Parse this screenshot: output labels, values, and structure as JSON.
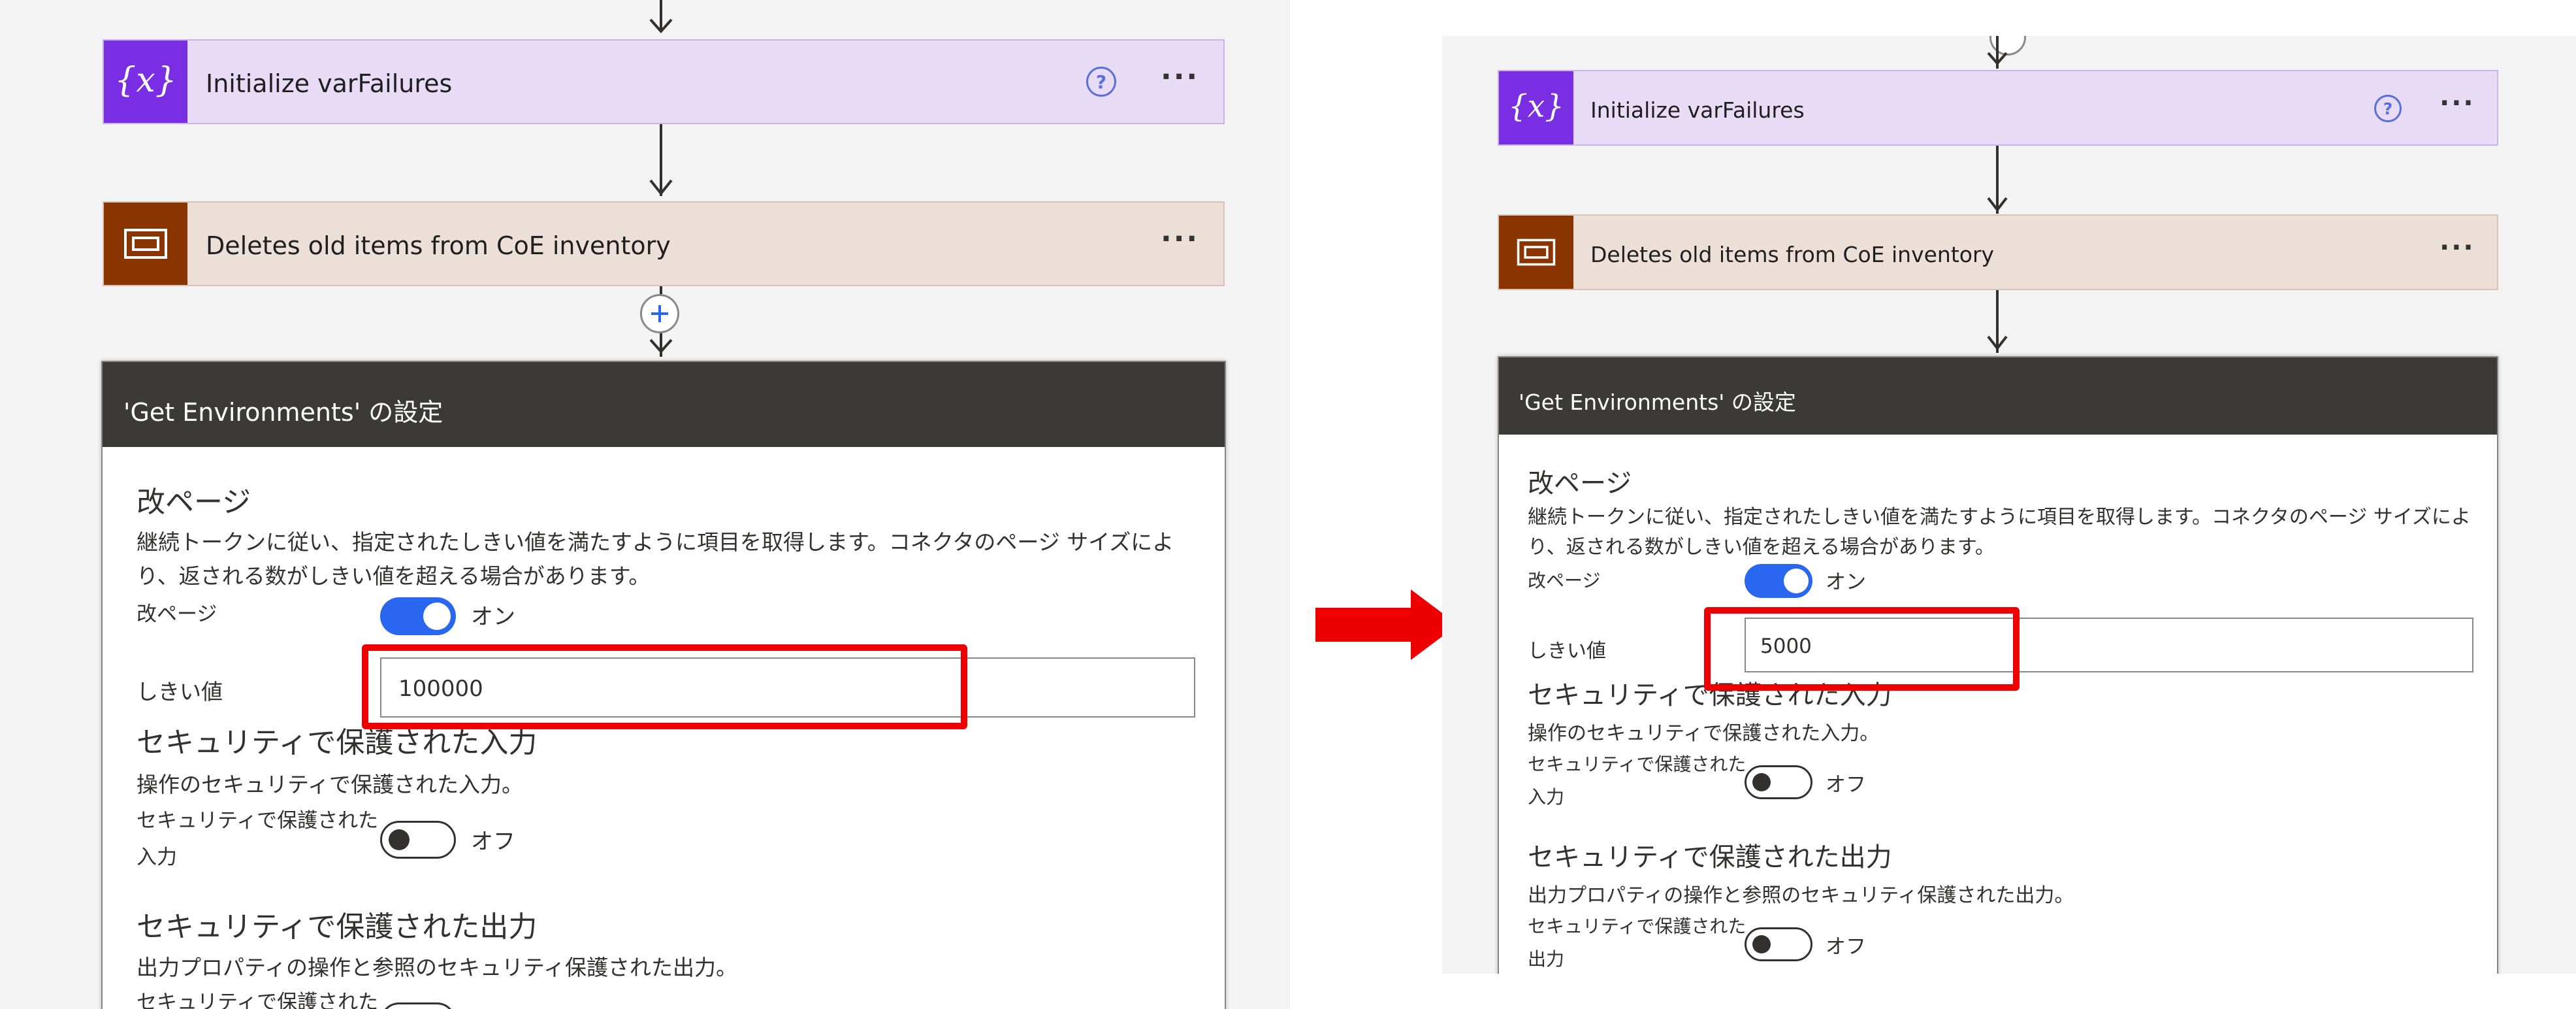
{
  "actions": {
    "variable_step": {
      "title": "Initialize varFailures",
      "icon": "variable-braces-icon",
      "help": "?",
      "more": "···"
    },
    "scope_step": {
      "title": "Deletes old items from CoE inventory",
      "icon": "scope-icon",
      "more": "···"
    }
  },
  "settings": {
    "header": "'Get Environments' の設定",
    "pagination": {
      "heading": "改ページ",
      "description": "継続トークンに従い、指定されたしきい値を満たすように項目を取得します。コネクタのページ サイズにより、返される数がしきい値を超える場合があります。",
      "toggle_label": "改ページ",
      "toggle_state": "オン",
      "threshold_label": "しきい値"
    },
    "secure_inputs": {
      "heading": "セキュリティで保護された入力",
      "description": "操作のセキュリティで保護された入力。",
      "toggle_label": "セキュリティで保護された入力",
      "toggle_state": "オフ"
    },
    "secure_outputs": {
      "heading": "セキュリティで保護された出力",
      "description": "出力プロパティの操作と参照のセキュリティ保護された出力。",
      "toggle_label": "セキュリティで保護された出力",
      "toggle_state": "オフ"
    }
  },
  "before": {
    "threshold_value": "100000"
  },
  "after": {
    "threshold_value": "5000"
  },
  "colors": {
    "variable_tile": "#7a2ee3",
    "scope_tile": "#8a3400",
    "toggle_on": "#2a67f0",
    "highlight": "#ee0000",
    "arrow": "#ee0000"
  }
}
